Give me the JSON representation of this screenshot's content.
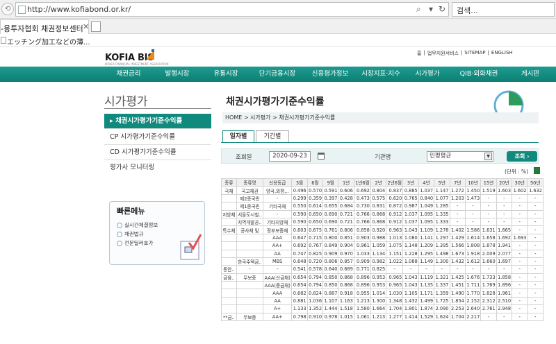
{
  "browser": {
    "url": "http://www.kofiabond.or.kr/",
    "search_placeholder": "검색...",
    "tab_title": "-융투자협회 채권정보센터",
    "favorite_label": "エッチング加工などの薄..."
  },
  "site": {
    "logo": "KOFIA BIS",
    "logo_sub": "KOREA FINANCIAL INVESTMENT ASSOCIATION",
    "top_links": [
      "홈",
      "업무지원서비스",
      "SITEMAP",
      "ENGLISH"
    ]
  },
  "nav": [
    "채권금리",
    "발행시장",
    "유통시장",
    "단기금융시장",
    "신용평가정보",
    "시장지표·지수",
    "시가평가",
    "QIB·외화채권",
    "게시판"
  ],
  "sidebar": {
    "title": "시가평가",
    "items": [
      {
        "label": "채권시가평가기준수익률",
        "active": true
      },
      {
        "label": "CP 시가평가기준수익률",
        "active": false
      },
      {
        "label": "CD 시가평가기준수익률",
        "active": false
      },
      {
        "label": "평가사 모니터링",
        "active": false
      }
    ],
    "quick_menu": {
      "title": "빠른메뉴",
      "items": [
        "실시간체결정보",
        "채권법규",
        "전문딜러호가"
      ]
    }
  },
  "main": {
    "title": "채권시가평가기준수익률",
    "breadcrumb": "HOME > 시가평가 > 채권시가평가기준수익률",
    "tabs": [
      "일자별",
      "기간별"
    ],
    "form": {
      "date_label": "조회일",
      "date_value": "2020-09-23",
      "inst_label": "기관명",
      "inst_value": "민평평균",
      "search_button": "조회"
    },
    "unit": "(단위 : %)"
  },
  "table": {
    "headers": [
      "종류",
      "종류명",
      "신용등급",
      "3월",
      "6월",
      "9월",
      "1년",
      "1년6월",
      "2년",
      "2년6월",
      "3년",
      "4년",
      "5년",
      "7년",
      "10년",
      "15년",
      "20년",
      "30년",
      "50년"
    ],
    "rows": [
      [
        "국채",
        "국고채권",
        "양곡,외평,..",
        "0.496",
        "0.570",
        "0.591",
        "0.606",
        "0.692",
        "0.804",
        "0.837",
        "0.885",
        "1.037",
        "1.147",
        "1.272",
        "1.450",
        "1.519",
        "1.603",
        "1.602",
        "1.632"
      ],
      [
        "",
        "제2종국민",
        "-",
        "0.299",
        "0.359",
        "0.397",
        "0.428",
        "0.473",
        "0.575",
        "0.620",
        "0.765",
        "0.840",
        "1.077",
        "1.203",
        "1.473",
        "-",
        "-",
        "-",
        "-"
      ],
      [
        "",
        "제1종국민",
        "기타국채",
        "0.550",
        "0.614",
        "0.655",
        "0.684",
        "0.730",
        "0.831",
        "0.872",
        "0.987",
        "1.049",
        "1.285",
        "-",
        "-",
        "-",
        "-",
        "-",
        "-"
      ],
      [
        "지방채",
        "서울도시철..",
        "-",
        "0.590",
        "0.650",
        "0.690",
        "0.721",
        "0.766",
        "0.868",
        "0.912",
        "1.037",
        "1.095",
        "1.335",
        "-",
        "-",
        "-",
        "-",
        "-",
        "-"
      ],
      [
        "",
        "지역개발공..",
        "기타지방채",
        "0.590",
        "0.650",
        "0.690",
        "0.721",
        "0.766",
        "0.868",
        "0.912",
        "1.037",
        "1.095",
        "1.333",
        "-",
        "-",
        "-",
        "-",
        "-",
        "-"
      ],
      [
        "특수채",
        "공사채 및",
        "정부보증채",
        "0.603",
        "0.675",
        "0.761",
        "0.806",
        "0.858",
        "0.920",
        "0.963",
        "1.043",
        "1.109",
        "1.278",
        "1.402",
        "1.586",
        "1.631",
        "1.665",
        "-",
        "-"
      ],
      [
        "",
        "",
        "AAA",
        "0.647",
        "0.715",
        "0.800",
        "0.851",
        "0.903",
        "0.988",
        "1.013",
        "1.080",
        "1.141",
        "1.297",
        "1.429",
        "1.614",
        "1.658",
        "1.692",
        "1.693",
        "-"
      ],
      [
        "",
        "",
        "AA+",
        "0.692",
        "0.767",
        "0.849",
        "0.904",
        "0.961",
        "1.059",
        "1.075",
        "1.148",
        "1.209",
        "1.395",
        "1.566",
        "1.808",
        "1.878",
        "1.941",
        "-",
        "-"
      ],
      [
        "",
        "",
        "AA",
        "0.747",
        "0.825",
        "0.909",
        "0.970",
        "1.033",
        "1.134",
        "1.151",
        "1.228",
        "1.295",
        "1.498",
        "1.673",
        "1.918",
        "2.009",
        "2.077",
        "-",
        "-"
      ],
      [
        "",
        "한국주택금..",
        "MBS",
        "0.648",
        "0.720",
        "0.806",
        "0.857",
        "0.909",
        "0.982",
        "1.022",
        "1.088",
        "1.149",
        "1.300",
        "1.432",
        "1.612",
        "1.660",
        "1.697",
        "-",
        "-"
      ],
      [
        "통안..",
        "-",
        "-",
        "0.541",
        "0.578",
        "0.640",
        "0.689",
        "0.771",
        "0.825",
        "-",
        "-",
        "-",
        "-",
        "-",
        "-",
        "-",
        "-",
        "-",
        "-"
      ],
      [
        "금융..",
        "무보증",
        "AAA(산금채)",
        "0.654",
        "0.794",
        "0.850",
        "0.868",
        "0.896",
        "0.953",
        "0.965",
        "1.043",
        "1.119",
        "1.321",
        "1.425",
        "1.676",
        "1.733",
        "1.858",
        "-",
        "-"
      ],
      [
        "",
        "",
        "AAA(중금채)",
        "0.654",
        "0.794",
        "0.850",
        "0.868",
        "0.896",
        "0.953",
        "0.965",
        "1.043",
        "1.135",
        "1.337",
        "1.451",
        "1.711",
        "1.769",
        "1.896",
        "-",
        "-"
      ],
      [
        "",
        "",
        "AAA",
        "0.682",
        "0.824",
        "0.887",
        "0.918",
        "0.955",
        "1.014",
        "1.030",
        "1.105",
        "1.171",
        "1.359",
        "1.490",
        "1.770",
        "1.828",
        "1.961",
        "-",
        "-"
      ],
      [
        "",
        "",
        "AA",
        "0.881",
        "1.036",
        "1.107",
        "1.163",
        "1.213",
        "1.300",
        "1.348",
        "1.432",
        "1.499",
        "1.725",
        "1.854",
        "2.152",
        "2.312",
        "2.510",
        "-",
        "-"
      ],
      [
        "",
        "",
        "A+",
        "1.133",
        "1.352",
        "1.444",
        "1.518",
        "1.580",
        "1.664",
        "1.704",
        "1.801",
        "1.874",
        "2.090",
        "2.253",
        "2.640",
        "2.761",
        "2.948",
        "-",
        "-"
      ],
      [
        "**금..",
        "무보증",
        "AA+",
        "0.798",
        "0.910",
        "0.978",
        "1.015",
        "1.061",
        "1.213",
        "1.277",
        "1.414",
        "1.529",
        "1.624",
        "1.704",
        "2.217",
        "-",
        "-",
        "-",
        "-"
      ]
    ]
  },
  "colors": {
    "accent": "#118a7e",
    "nav_top": "#1d9b8f"
  }
}
